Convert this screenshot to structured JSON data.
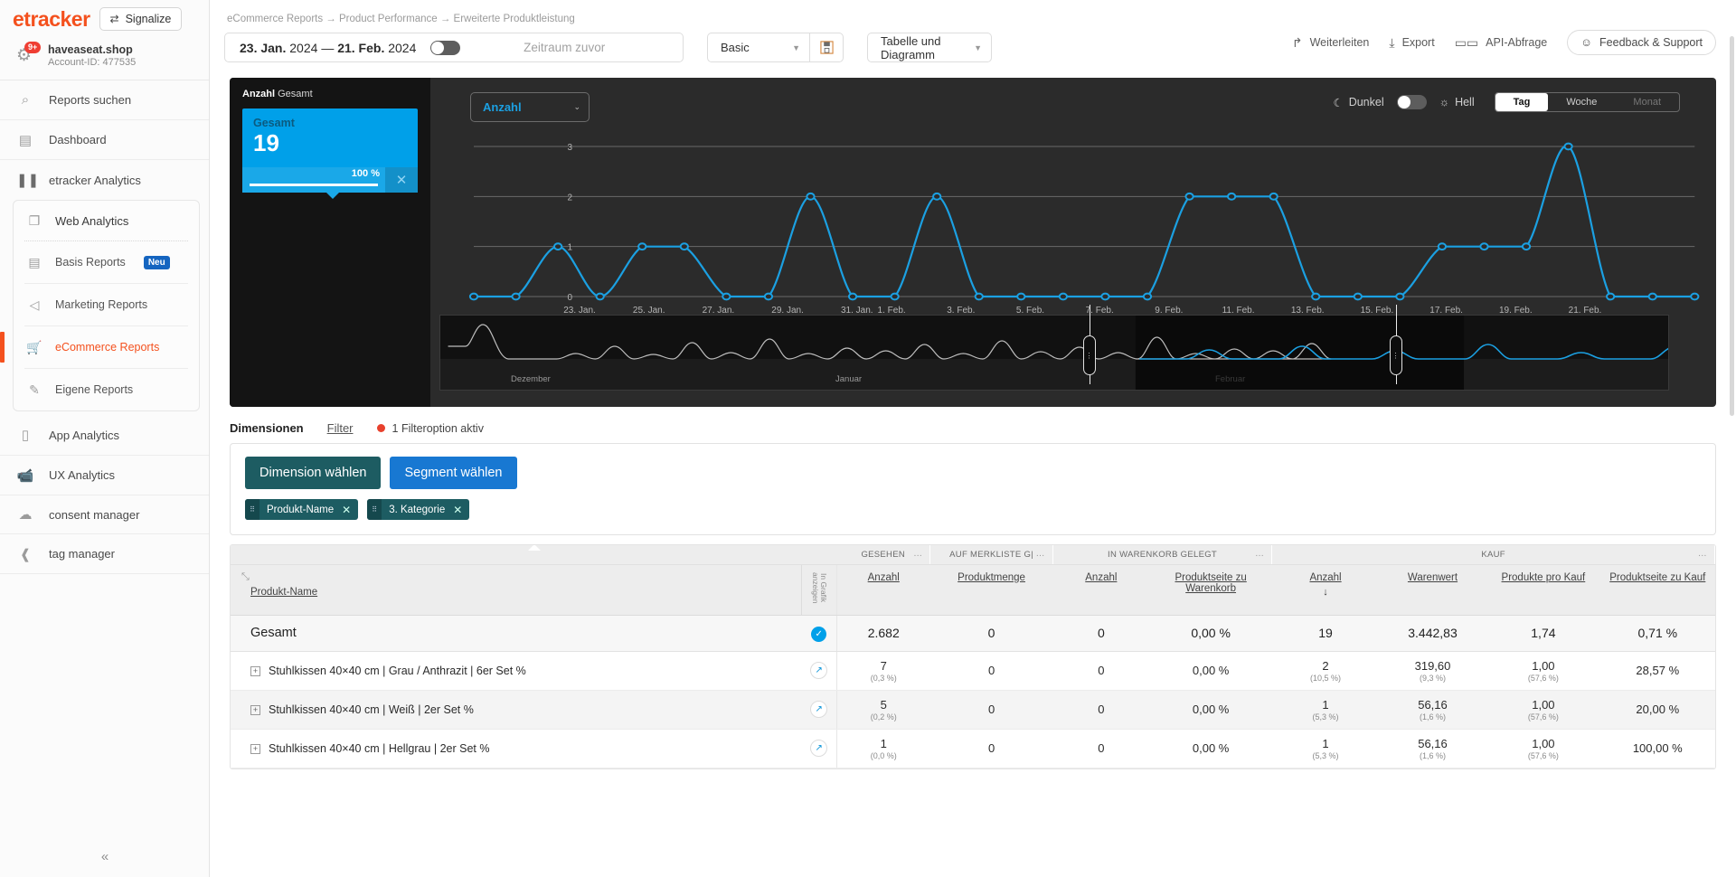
{
  "sidebar": {
    "logo": "etracker",
    "signalize_label": "Signalize",
    "signalize_icon": "swap-icon",
    "account_name": "haveaseat.shop",
    "account_id": "Account-ID: 477535",
    "badge": "9+",
    "items": [
      {
        "label": "Reports suchen",
        "icon": "search-icon"
      },
      {
        "label": "Dashboard",
        "icon": "dashboard-icon"
      },
      {
        "label": "etracker Analytics",
        "icon": "analytics-icon"
      }
    ],
    "group": {
      "header": {
        "label": "Web Analytics",
        "icon": "window-icon"
      },
      "sub_items": [
        {
          "label": "Basis Reports",
          "icon": "database-icon",
          "badge": "Neu",
          "active": false
        },
        {
          "label": "Marketing Reports",
          "icon": "megaphone-icon",
          "badge": "",
          "active": false
        },
        {
          "label": "eCommerce Reports",
          "icon": "cart-icon",
          "badge": "",
          "active": true
        },
        {
          "label": "Eigene Reports",
          "icon": "pencil-icon",
          "badge": "",
          "active": false
        }
      ]
    },
    "items_after": [
      {
        "label": "App Analytics",
        "icon": "mobile-icon"
      },
      {
        "label": "UX Analytics",
        "icon": "camera-icon"
      },
      {
        "label": "consent manager",
        "icon": "cloud-icon"
      },
      {
        "label": "tag manager",
        "icon": "tag-icon"
      }
    ],
    "collapse_icon": "chevron-double-left-icon"
  },
  "topbar": {
    "breadcrumb": "eCommerce Reports → Product Performance → Erweiterte Produktleistung",
    "date_from_day": "23. Jan.",
    "date_from_year": "2024",
    "date_sep": "—",
    "date_to_day": "21. Feb.",
    "date_to_year": "2024",
    "compare_label": "Zeitraum zuvor",
    "preset_value": "Basic",
    "save_icon": "floppy-disk-icon",
    "view_value": "Tabelle und Diagramm",
    "actions": [
      {
        "label": "Weiterleiten",
        "icon": "share-arrow-icon"
      },
      {
        "label": "Export",
        "icon": "download-box-icon"
      },
      {
        "label": "API-Abfrage",
        "icon": "api-icon"
      }
    ],
    "feedback_label": "Feedback & Support",
    "feedback_icon": "smiley-icon"
  },
  "chart_panel": {
    "metric_title_bold": "Anzahl",
    "metric_title_rest": " Gesamt",
    "card": {
      "label": "Gesamt",
      "value": "19",
      "percent": "100 %",
      "close_icon": "close-icon"
    },
    "metric_select": "Anzahl",
    "theme_dark": "Dunkel",
    "theme_light": "Hell",
    "dark_icon": "moon-icon",
    "light_icon": "sun-icon",
    "granularity": [
      {
        "label": "Tag",
        "state": "selected"
      },
      {
        "label": "Woche",
        "state": "normal"
      },
      {
        "label": "Monat",
        "state": "disabled"
      }
    ],
    "navigator": {
      "labels": [
        "Dezember",
        "Januar",
        "Februar"
      ],
      "handle_icon": "drag-handle-icon"
    }
  },
  "chart_data": {
    "type": "line",
    "title": "Anzahl Gesamt",
    "xlabel": "",
    "ylabel": "Anzahl",
    "ylim": [
      0,
      3
    ],
    "yticks": [
      0,
      1,
      2,
      3
    ],
    "grid": true,
    "legend": "none",
    "x": [
      "23. Jan.",
      "24. Jan.",
      "25. Jan.",
      "26. Jan.",
      "27. Jan.",
      "28. Jan.",
      "29. Jan.",
      "30. Jan.",
      "31. Jan.",
      "1. Feb.",
      "2. Feb.",
      "3. Feb.",
      "4. Feb.",
      "5. Feb.",
      "6. Feb.",
      "7. Feb.",
      "8. Feb.",
      "9. Feb.",
      "10. Feb.",
      "11. Feb.",
      "12. Feb.",
      "13. Feb.",
      "14. Feb.",
      "15. Feb.",
      "16. Feb.",
      "17. Feb.",
      "18. Feb.",
      "19. Feb.",
      "20. Feb.",
      "21. Feb."
    ],
    "tick_labels": [
      "23. Jan.",
      "25. Jan.",
      "27. Jan.",
      "29. Jan.",
      "31. Jan.",
      "1. Feb.",
      "3. Feb.",
      "5. Feb.",
      "7. Feb.",
      "9. Feb.",
      "11. Feb.",
      "13. Feb.",
      "15. Feb.",
      "17. Feb.",
      "19. Feb.",
      "21. Feb."
    ],
    "series": [
      {
        "name": "Anzahl",
        "color": "#1ba0e2",
        "values": [
          0,
          0,
          1,
          0,
          1,
          1,
          0,
          0,
          2,
          0,
          0,
          2,
          0,
          0,
          0,
          0,
          0,
          2,
          2,
          2,
          0,
          0,
          0,
          1,
          1,
          1,
          3,
          0,
          0,
          0
        ]
      }
    ]
  },
  "dimensions": {
    "tab_label": "Dimensionen",
    "filter_label": "Filter",
    "filter_active": "1 Filteroption aktiv",
    "choose_dimension": "Dimension wählen",
    "choose_segment": "Segment wählen",
    "chips": [
      {
        "label": "Produkt-Name"
      },
      {
        "label": "3. Kategorie"
      }
    ]
  },
  "table": {
    "expand_icon": "collapse-arrows-icon",
    "name_header": "Produkt-Name",
    "graphic_col_label": "In Grafik\nanzeigen",
    "groups": [
      {
        "label": "GESEHEN",
        "span": 1,
        "menu": "…"
      },
      {
        "label": "AUF MERKLISTE G|",
        "span": 1,
        "menu": "…"
      },
      {
        "label": "IN WARENKORB GELEGT",
        "span": 2,
        "menu": "…"
      },
      {
        "label": "KAUF",
        "span": 4,
        "menu": "…"
      }
    ],
    "columns": [
      {
        "label": "Anzahl",
        "sorted": false
      },
      {
        "label": "Produktmenge",
        "sorted": false
      },
      {
        "label": "Anzahl",
        "sorted": false
      },
      {
        "label": "Produktseite zu Warenkorb",
        "sorted": false
      },
      {
        "label": "Anzahl",
        "sorted": true,
        "sort_arrow": "↓"
      },
      {
        "label": "Warenwert",
        "sorted": false
      },
      {
        "label": "Produkte pro Kauf",
        "sorted": false
      },
      {
        "label": "Produktseite zu Kauf",
        "sorted": false
      }
    ],
    "total_row": {
      "name": "Gesamt",
      "values": [
        "2.682",
        "0",
        "0",
        "0,00 %",
        "19",
        "3.442,83",
        "1,74",
        "0,71 %"
      ]
    },
    "rows": [
      {
        "name": "Stuhlkissen 40×40 cm | Grau / Anthrazit | 6er Set %",
        "cells": [
          {
            "v": "7",
            "s": "(0,3 %)"
          },
          {
            "v": "0",
            "s": ""
          },
          {
            "v": "0",
            "s": ""
          },
          {
            "v": "0,00 %",
            "s": ""
          },
          {
            "v": "2",
            "s": "(10,5 %)"
          },
          {
            "v": "319,60",
            "s": "(9,3 %)"
          },
          {
            "v": "1,00",
            "s": "(57,6 %)"
          },
          {
            "v": "28,57 %",
            "s": ""
          }
        ]
      },
      {
        "name": "Stuhlkissen 40×40 cm | Weiß | 2er Set %",
        "cells": [
          {
            "v": "5",
            "s": "(0,2 %)"
          },
          {
            "v": "0",
            "s": ""
          },
          {
            "v": "0",
            "s": ""
          },
          {
            "v": "0,00 %",
            "s": ""
          },
          {
            "v": "1",
            "s": "(5,3 %)"
          },
          {
            "v": "56,16",
            "s": "(1,6 %)"
          },
          {
            "v": "1,00",
            "s": "(57,6 %)"
          },
          {
            "v": "20,00 %",
            "s": ""
          }
        ]
      },
      {
        "name": "Stuhlkissen 40×40 cm | Hellgrau | 2er Set %",
        "cells": [
          {
            "v": "1",
            "s": "(0,0 %)"
          },
          {
            "v": "0",
            "s": ""
          },
          {
            "v": "0",
            "s": ""
          },
          {
            "v": "0,00 %",
            "s": ""
          },
          {
            "v": "1",
            "s": "(5,3 %)"
          },
          {
            "v": "56,16",
            "s": "(1,6 %)"
          },
          {
            "v": "1,00",
            "s": "(57,6 %)"
          },
          {
            "v": "100,00 %",
            "s": ""
          }
        ]
      }
    ]
  },
  "colors": {
    "brand": "#f4511e",
    "chart_line": "#1ba0e2",
    "accent_blue": "#1878d2",
    "teal": "#1d5c62",
    "card": "#00a0e9"
  }
}
